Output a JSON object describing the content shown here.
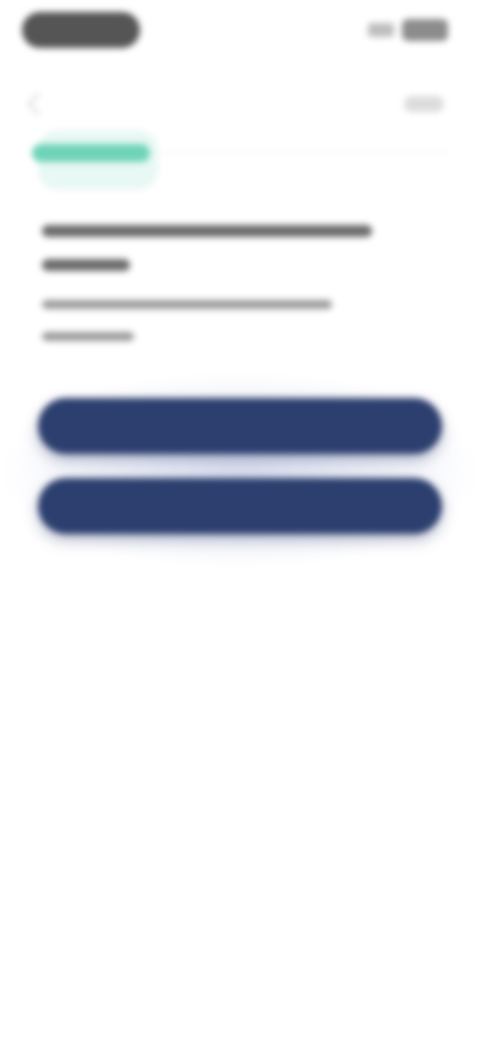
{
  "status_bar": {
    "pill_color": "#555555",
    "battery_color": "#8c8c8c"
  },
  "top_bar": {
    "back_icon": "chevron-left-icon",
    "right_action_label": ""
  },
  "tag": {
    "label": "",
    "color": "#6fd3b8"
  },
  "content": {
    "heading_line_1": "",
    "heading_line_2": "",
    "description_line_1": "",
    "description_line_2": ""
  },
  "buttons": {
    "primary_label": "",
    "secondary_label": "",
    "color": "#2d3f6f"
  }
}
